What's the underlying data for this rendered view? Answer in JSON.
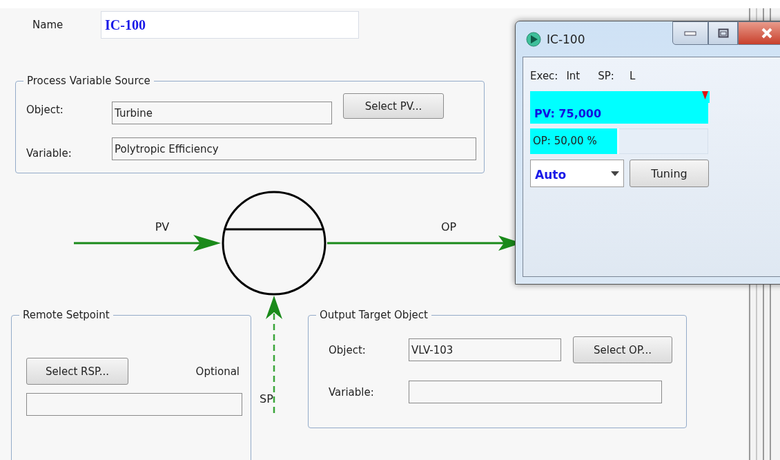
{
  "form": {
    "name_label": "Name",
    "name_value": "IC-100"
  },
  "pv_source": {
    "title": "Process Variable Source",
    "object_label": "Object:",
    "object_value": "Turbine",
    "select_button": "Select PV...",
    "variable_label": "Variable:",
    "variable_value": "Polytropic Efficiency"
  },
  "diagram": {
    "pv_label": "PV",
    "op_label": "OP",
    "sp_label": "SP"
  },
  "remote_setpoint": {
    "title": "Remote Setpoint",
    "select_button": "Select RSP...",
    "optional_label": "Optional"
  },
  "output_target": {
    "title": "Output Target Object",
    "object_label": "Object:",
    "object_value": "VLV-103",
    "select_button": "Select OP...",
    "variable_label": "Variable:"
  },
  "faceplate": {
    "title": "IC-100",
    "exec_label": "Exec:",
    "exec_value": "Int",
    "sp_label": "SP:",
    "sp_value": "L",
    "pv_reading": "PV: 75,000",
    "op_meter": {
      "reading": "OP: 50,00 %",
      "level": 0.5
    },
    "mode": "Auto",
    "tuning_button": "Tuning"
  }
}
